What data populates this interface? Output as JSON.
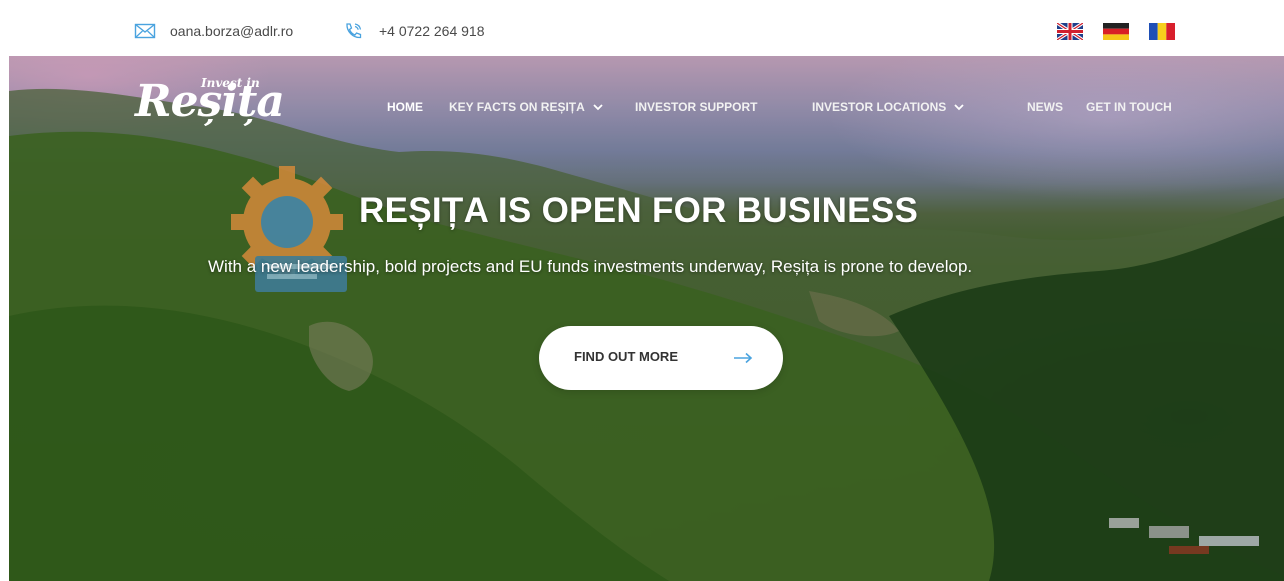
{
  "topbar": {
    "email": "oana.borza@adlr.ro",
    "phone": "+4 0722 264 918",
    "email_icon": "envelope-icon",
    "phone_icon": "phone-icon"
  },
  "languages": [
    {
      "code": "en",
      "icon": "uk-flag-icon"
    },
    {
      "code": "de",
      "icon": "germany-flag-icon"
    },
    {
      "code": "ro",
      "icon": "romania-flag-icon"
    }
  ],
  "logo": {
    "small_text": "Invest in",
    "main_text": "Reșița"
  },
  "nav": {
    "home": "HOME",
    "key_facts": "KEY FACTS ON REȘIȚA",
    "investor_support": "INVESTOR SUPPORT",
    "investor_locations": "INVESTOR LOCATIONS",
    "news": "NEWS",
    "get_in_touch": "GET IN TOUCH"
  },
  "hero": {
    "title": "REȘIȚA IS OPEN FOR BUSINESS",
    "subtitle": "With a new leadership, bold projects and EU funds investments underway, Reșița is prone to develop.",
    "cta_label": "FIND OUT MORE",
    "cta_icon": "arrow-right-icon"
  },
  "colors": {
    "accent": "#4aa3df",
    "gear": "#d48a3a",
    "text_dark": "#333333"
  }
}
